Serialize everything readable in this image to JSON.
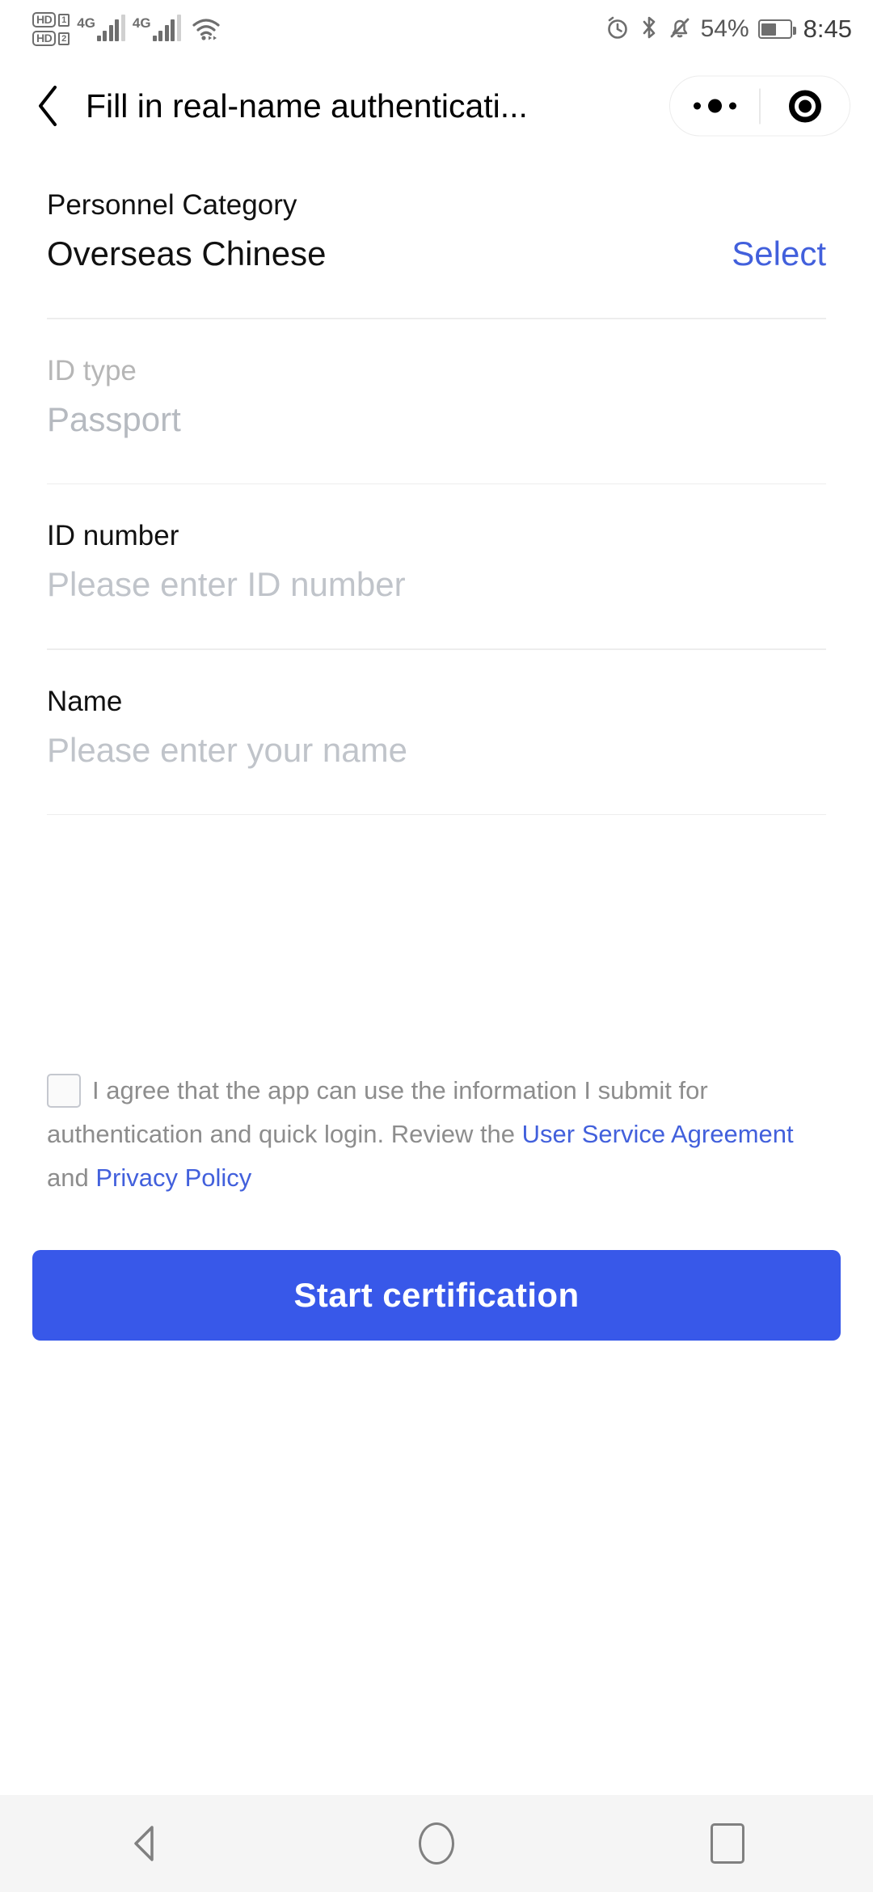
{
  "statusbar": {
    "sim1_hd": "HD",
    "sim1_num": "1",
    "sim2_hd": "HD",
    "sim2_num": "2",
    "net1": "4G",
    "net2": "4G",
    "wifi_icon": "wifi-icon",
    "alarm_icon": "alarm-icon",
    "bluetooth_icon": "bluetooth-icon",
    "mute_icon": "bell-muted-icon",
    "battery_percent": "54%",
    "battery_level": 54,
    "time": "8:45"
  },
  "header": {
    "back_icon": "chevron-left-icon",
    "title": "Fill in real-name authenticati...",
    "capsule": {
      "more_icon": "more-dots-icon",
      "target_icon": "target-circle-icon"
    }
  },
  "form": {
    "personnel_category": {
      "label": "Personnel Category",
      "value": "Overseas Chinese",
      "action_label": "Select"
    },
    "id_type": {
      "label": "ID type",
      "value": "Passport"
    },
    "id_number": {
      "label": "ID number",
      "placeholder": "Please enter ID number",
      "value": ""
    },
    "name": {
      "label": "Name",
      "placeholder": "Please enter your name",
      "value": ""
    }
  },
  "agreement": {
    "checked": false,
    "text_part1": "I agree that the app can use the information I submit for authentication and quick login. Review the ",
    "link1": "User Service Agreement",
    "text_part2": " and ",
    "link2": "Privacy Policy"
  },
  "cta": {
    "label": "Start certification"
  },
  "navbar": {
    "back_icon": "nav-back-triangle-icon",
    "home_icon": "nav-home-circle-icon",
    "recents_icon": "nav-recents-square-icon"
  },
  "colors": {
    "primary_blue": "#3858E9",
    "link_blue": "#4260DC",
    "muted_grey": "#b6bac0",
    "placeholder_grey": "#c0c4ca",
    "divider": "#ededed"
  }
}
